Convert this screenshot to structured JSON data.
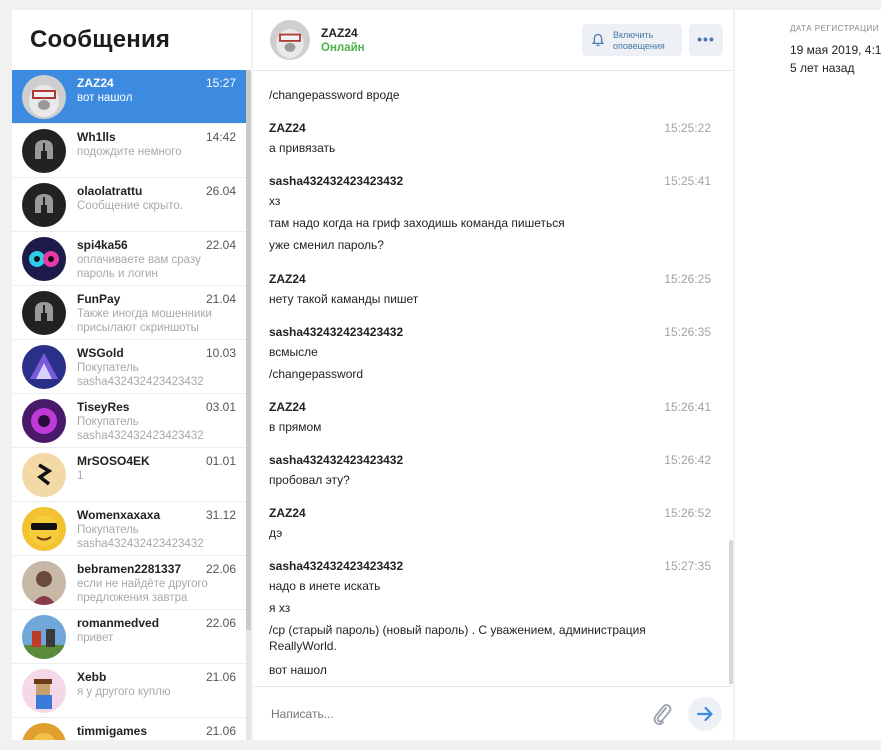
{
  "sidebar": {
    "title": "Сообщения",
    "dialogs": [
      {
        "name": "ZAZ24",
        "time": "15:27",
        "preview": "вот нашол"
      },
      {
        "name": "Wh1lls",
        "time": "14:42",
        "preview": "подождите немного"
      },
      {
        "name": "olaolatrattu",
        "time": "26.04",
        "preview": "Сообщение скрыто."
      },
      {
        "name": "spi4ka56",
        "time": "22.04",
        "preview": "оплачиваете вам сразу пароль и логин"
      },
      {
        "name": "FunPay",
        "time": "21.04",
        "preview": "Также иногда мошенники присылают скриншоты"
      },
      {
        "name": "WSGold",
        "time": "10.03",
        "preview": "Покупатель sasha432432423423432"
      },
      {
        "name": "TiseyRes",
        "time": "03.01",
        "preview": "Покупатель sasha432432423423432"
      },
      {
        "name": "MrSOSO4EK",
        "time": "01.01",
        "preview": "1"
      },
      {
        "name": "Womenxaxaxa",
        "time": "31.12",
        "preview": "Покупатель sasha432432423423432"
      },
      {
        "name": "bebramen2281337",
        "time": "22.06",
        "preview": "если не найдёте другого предложения завтра"
      },
      {
        "name": "romanmedved",
        "time": "22.06",
        "preview": "привет"
      },
      {
        "name": "Xebb",
        "time": "21.06",
        "preview": "я у другого куплю"
      },
      {
        "name": "timmigames",
        "time": "21.06",
        "preview": ""
      }
    ]
  },
  "chat": {
    "name": "ZAZ24",
    "status": "Онлайн",
    "notify_label": "Включить оповещения",
    "more_label": "•••",
    "top_line": "/changepassword вроде",
    "groups": [
      {
        "author": "ZAZ24",
        "time": "15:25:22",
        "lines": [
          "а привязать"
        ]
      },
      {
        "author": "sasha432432423423432",
        "time": "15:25:41",
        "lines": [
          "хз",
          "там надо когда на гриф заходишь команда пишеться",
          "уже сменил пароль?"
        ]
      },
      {
        "author": "ZAZ24",
        "time": "15:26:25",
        "lines": [
          "нету такой каманды пишет"
        ]
      },
      {
        "author": "sasha432432423423432",
        "time": "15:26:35",
        "lines": [
          "всмысле",
          "/changepassword"
        ]
      },
      {
        "author": "ZAZ24",
        "time": "15:26:41",
        "lines": [
          "в прямом"
        ]
      },
      {
        "author": "sasha432432423423432",
        "time": "15:26:42",
        "lines": [
          "пробовал эту?"
        ]
      },
      {
        "author": "ZAZ24",
        "time": "15:26:52",
        "lines": [
          "дэ"
        ]
      },
      {
        "author": "sasha432432423423432",
        "time": "15:27:35",
        "lines": [
          "надо в инете искать",
          "я хз",
          "/cp (старый пароль) (новый пароль) . С уважением, администрация ReallyWorld.",
          "вот нашол"
        ]
      }
    ],
    "composer_placeholder": "Написать..."
  },
  "info": {
    "reg_label": "ДАТА РЕГИСТРАЦИИ",
    "reg_date": "19 мая 2019, 4:1",
    "reg_ago": "5 лет назад"
  },
  "colors": {
    "accent": "#3d8be0",
    "online": "#4bb34b",
    "link": "#4a76a8",
    "muted": "#a5a9ae"
  }
}
